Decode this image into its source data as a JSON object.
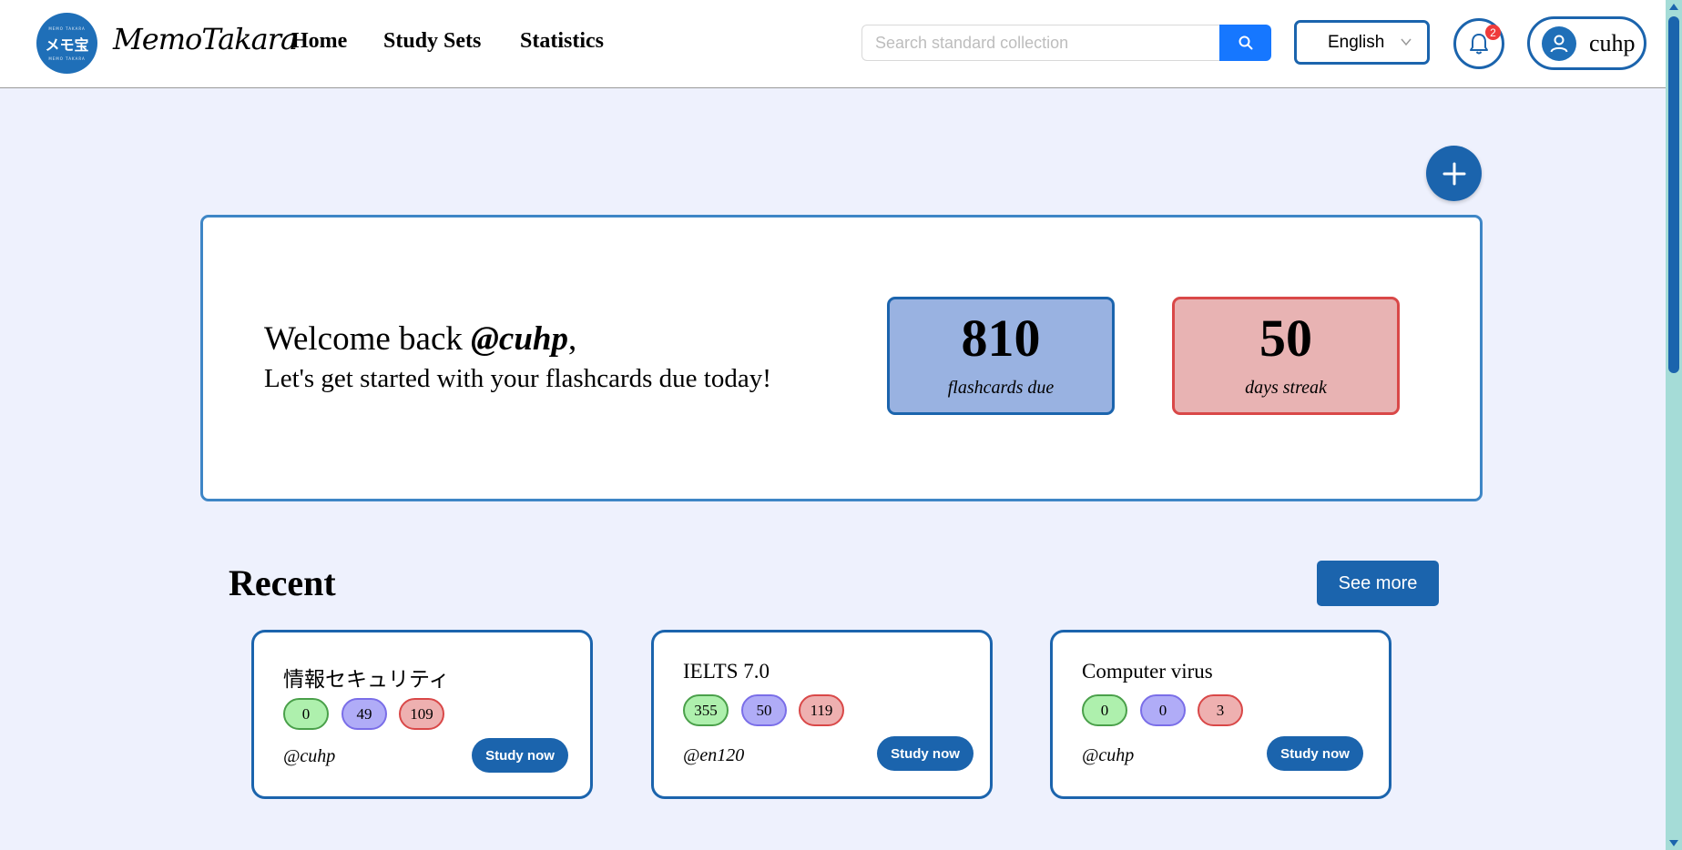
{
  "colors": {
    "primary": "#1b64ad",
    "search_button": "#1677ff",
    "page_bg": "#eef1fd",
    "due_bg": "#99b2e1",
    "streak_bg": "#e8b3b3"
  },
  "header": {
    "logo_small_text": "MEMO TAKARA",
    "logo_main_text": "メモ宝",
    "brand": "MemoTakara",
    "nav": [
      "Home",
      "Study Sets",
      "Statistics"
    ],
    "search_placeholder": "Search standard collection",
    "search_icon": "search-icon",
    "language": "English",
    "notification_count": "2",
    "username": "cuhp"
  },
  "welcome": {
    "greeting_prefix": "Welcome back ",
    "greeting_user": "@cuhp",
    "greeting_suffix": ",",
    "subtitle": "Let's get started with your flashcards due today!",
    "due_count": "810",
    "due_label": "flashcards due",
    "streak_count": "50",
    "streak_label": "days streak"
  },
  "recent": {
    "title": "Recent",
    "see_more": "See more",
    "sets": [
      {
        "title": "情報セキュリティ",
        "new": "0",
        "learning": "49",
        "due": "109",
        "owner": "@cuhp",
        "study_label": "Study now"
      },
      {
        "title": "IELTS 7.0",
        "new": "355",
        "learning": "50",
        "due": "119",
        "owner": "@en120",
        "study_label": "Study now"
      },
      {
        "title": "Computer virus",
        "new": "0",
        "learning": "0",
        "due": "3",
        "owner": "@cuhp",
        "study_label": "Study now"
      }
    ]
  }
}
